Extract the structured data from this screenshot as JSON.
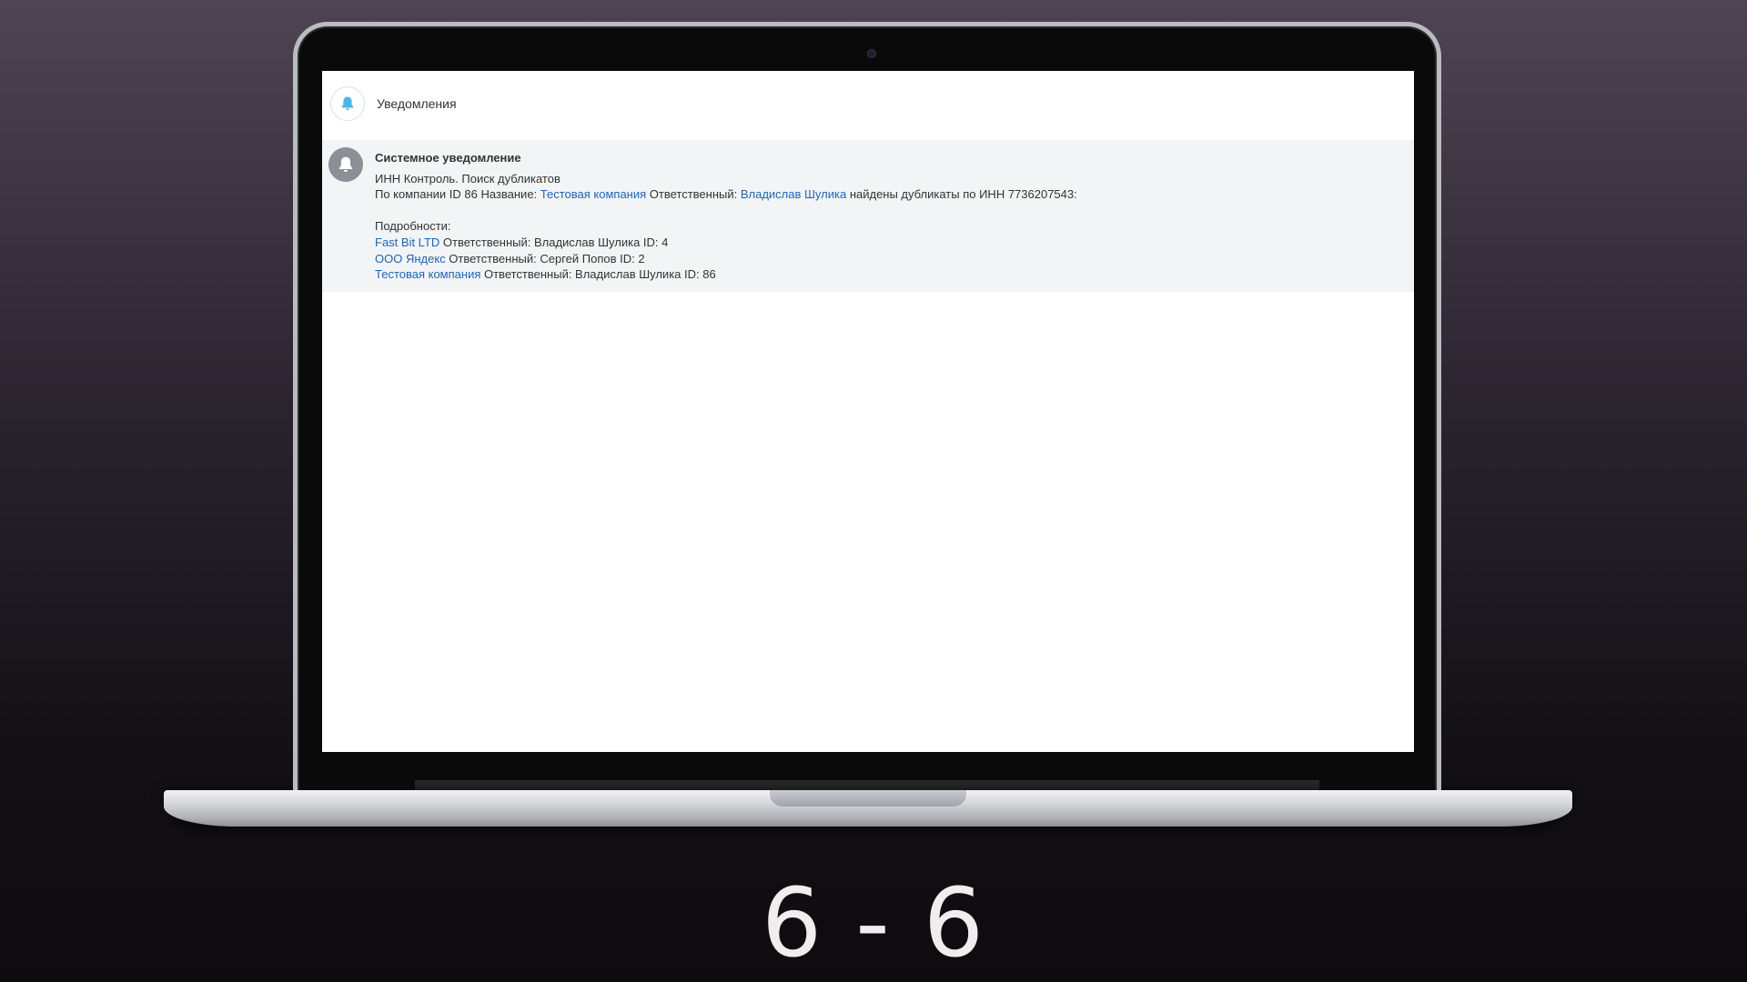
{
  "panel": {
    "title": "Уведомления"
  },
  "notification": {
    "title": "Системное уведомление",
    "line1": "ИНН Контроль. Поиск дубликатов",
    "line2": {
      "prefix": "По компании ID 86 Название: ",
      "company_link": "Тестовая компания",
      "responsible_label": " Ответственный: ",
      "user_link": "Владислав Шулика",
      "suffix": " найдены дубликаты по ИНН 7736207543:"
    },
    "details_label": "Подробности:",
    "duplicates": [
      {
        "link": "Fast Bit LTD",
        "text": " Ответственный: Владислав Шулика ID: 4"
      },
      {
        "link": "ООО Яндекс",
        "text": " Ответственный: Сергей Попов ID: 2"
      },
      {
        "link": "Тестовая компания",
        "text": " Ответственный: Владислав Шулика ID: 86"
      }
    ]
  },
  "page_counter": "6 - 6",
  "colors": {
    "link": "#2066b0",
    "bell_header": "#4fb3e8",
    "bell_avatar_bg": "#8a9096"
  },
  "icons": {
    "header": "bell-icon",
    "notification": "bell-icon"
  }
}
